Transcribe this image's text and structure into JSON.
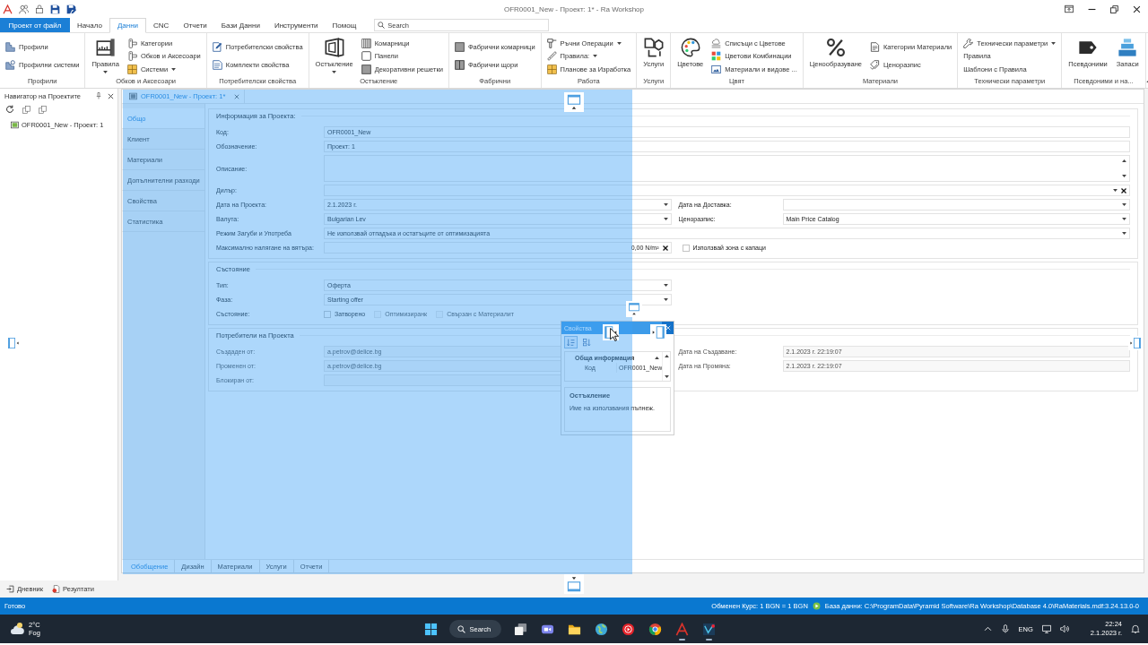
{
  "title_bar": {
    "title": "OFR0001_New - Проект: 1* - Ra Workshop"
  },
  "ribbon": {
    "file_button": "Проект от файл",
    "tabs": [
      {
        "label": "Начало",
        "selected": false
      },
      {
        "label": "Данни",
        "selected": true
      },
      {
        "label": "CNC",
        "selected": false
      },
      {
        "label": "Отчети",
        "selected": false
      },
      {
        "label": "Бази Данни",
        "selected": false
      },
      {
        "label": "Инструменти",
        "selected": false
      },
      {
        "label": "Помощ",
        "selected": false
      }
    ],
    "search": {
      "placeholder": "Search"
    },
    "groups": [
      {
        "label": "Профили",
        "items": [
          {
            "kind": "small",
            "label": "Профили",
            "dropdown": false
          },
          {
            "kind": "small",
            "label": "Профилни системи",
            "dropdown": false
          }
        ]
      },
      {
        "label": "Обков и Аксесоари",
        "items": [
          {
            "kind": "large",
            "label": "Правила",
            "dropdown": true
          },
          {
            "kind": "small",
            "label": "Категории",
            "dropdown": false
          },
          {
            "kind": "small",
            "label": "Обков и Аксесоари",
            "dropdown": false
          },
          {
            "kind": "small",
            "label": "Системи",
            "dropdown": true
          }
        ]
      },
      {
        "label": "Потребителски свойства",
        "items": [
          {
            "kind": "small",
            "label": "Потребителски свойства",
            "dropdown": false
          },
          {
            "kind": "small",
            "label": "Комплекти свойства",
            "dropdown": false
          }
        ]
      },
      {
        "label": "Остъкление",
        "items": [
          {
            "kind": "large",
            "label": "Остъкление",
            "dropdown": true
          },
          {
            "kind": "small",
            "label": "Комарници",
            "dropdown": false
          },
          {
            "kind": "small",
            "label": "Панели",
            "dropdown": false
          },
          {
            "kind": "small",
            "label": "Декоративни решетки",
            "dropdown": false
          }
        ]
      },
      {
        "label": "Фабрични",
        "items": [
          {
            "kind": "small",
            "label": "Фабрични комарници",
            "dropdown": false
          },
          {
            "kind": "small",
            "label": "Фабрични щори",
            "dropdown": false
          }
        ]
      },
      {
        "label": "Работа",
        "items": [
          {
            "kind": "small",
            "label": "Ръчни Операции",
            "dropdown": true
          },
          {
            "kind": "small",
            "label": "Правила:",
            "dropdown": true
          },
          {
            "kind": "small",
            "label": "Планове за Изработка",
            "dropdown": false
          }
        ]
      },
      {
        "label": "Услуги",
        "items": [
          {
            "kind": "large",
            "label": "Услуги",
            "dropdown": false
          }
        ]
      },
      {
        "label": "Цвят",
        "items": [
          {
            "kind": "large",
            "label": "Цветове",
            "dropdown": false
          },
          {
            "kind": "small",
            "label": "Списъци с Цветове",
            "dropdown": false
          },
          {
            "kind": "small",
            "label": "Цветови Комбинации",
            "dropdown": false
          },
          {
            "kind": "small",
            "label": "Материали и видове ...",
            "dropdown": false
          }
        ]
      },
      {
        "label": "Материали",
        "items": [
          {
            "kind": "large",
            "label": "Ценообразуване",
            "dropdown": false
          },
          {
            "kind": "small",
            "label": "Категории Материали",
            "dropdown": false
          },
          {
            "kind": "small",
            "label": "Ценоразпис",
            "dropdown": false
          }
        ]
      },
      {
        "label": "Технически параметри",
        "items": [
          {
            "kind": "small",
            "label": "Технически параметри",
            "dropdown": true
          },
          {
            "kind": "text",
            "label": "Правила",
            "dropdown": false
          },
          {
            "kind": "text",
            "label": "Шаблони с Правила",
            "dropdown": false
          }
        ]
      },
      {
        "label": "Псевдоними и на...",
        "items": [
          {
            "kind": "large",
            "label": "Псевдоними",
            "dropdown": false
          },
          {
            "kind": "large",
            "label": "Запаси",
            "dropdown": false
          }
        ]
      }
    ]
  },
  "navigator": {
    "title": "Навигатор на Проектите",
    "tree": [
      {
        "label": "OFR0001_New - Проект: 1"
      }
    ]
  },
  "document": {
    "tab": {
      "title": "OFR0001_New - Проект: 1*"
    },
    "nav": [
      {
        "label": "Общо",
        "selected": true
      },
      {
        "label": "Клиент",
        "selected": false
      },
      {
        "label": "Материали",
        "selected": false
      },
      {
        "label": "Допълнителни разходи",
        "selected": false
      },
      {
        "label": "Свойства",
        "selected": false
      },
      {
        "label": "Статистика",
        "selected": false
      }
    ],
    "sections": [
      {
        "title": "Информация за Проекта:",
        "rows": [
          {
            "fields": [
              {
                "kind": "text",
                "label": "Код:",
                "value": "OFR0001_New",
                "disabled": false
              }
            ]
          },
          {
            "fields": [
              {
                "kind": "text",
                "label": "Обозначение:",
                "value": "Проект: 1",
                "disabled": false
              }
            ]
          },
          {
            "fields": [
              {
                "kind": "memo",
                "label": "Описание:",
                "disabled": false
              }
            ]
          },
          {
            "fields": [
              {
                "kind": "lookup",
                "label": "Дилър:",
                "disabled": false
              }
            ]
          },
          {
            "fields": [
              {
                "kind": "combo",
                "label": "Дата на Проекта:",
                "value": "2.1.2023 г.",
                "disabled": false
              },
              {
                "kind": "combo",
                "label": "Дата на Доставка:",
                "disabled": false
              }
            ]
          },
          {
            "fields": [
              {
                "kind": "combo",
                "label": "Валута:",
                "value": "Bulgarian Lev",
                "disabled": false
              },
              {
                "kind": "combo",
                "label": "Ценоразпис:",
                "value": "Main Price Catalog",
                "disabled": false
              }
            ]
          },
          {
            "fields": [
              {
                "kind": "combo",
                "label": "Режим Загуби и Употреба",
                "value": "Не използвай отпадъка и остатъците от оптимизацията",
                "disabled": false
              }
            ]
          },
          {
            "fields": [
              {
                "kind": "number",
                "label": "Максимално налягане на вятъра:",
                "value": "0,00 N/m²",
                "disabled": false
              },
              {
                "kind": "checkbox",
                "label": "Използвай зона с капаци",
                "checked": false,
                "disabled": false
              }
            ]
          }
        ]
      },
      {
        "title": "Състояние",
        "rows": [
          {
            "fields": [
              {
                "kind": "combo",
                "label": "Тип:",
                "value": "Оферта",
                "disabled": false
              }
            ]
          },
          {
            "fields": [
              {
                "kind": "combo",
                "label": "Фаза:",
                "value": "Starting offer",
                "disabled": false
              }
            ]
          },
          {
            "fields": [
              {
                "kind": "checks",
                "label": "Състояние:",
                "disabled": false,
                "options": [
                  {
                    "label": "Затворено",
                    "checked": false,
                    "disabled": false
                  },
                  {
                    "label": "Оптимизиранк",
                    "checked": false,
                    "disabled": true
                  },
                  {
                    "label": "Свързан с Материалит",
                    "checked": false,
                    "disabled": true
                  }
                ]
              }
            ]
          }
        ]
      },
      {
        "title": "Потребители на Проекта",
        "rows": [
          {
            "fields": [
              {
                "kind": "text",
                "label": "Създаден от:",
                "value": "a.petrov@delice.bg",
                "disabled": true
              },
              {
                "kind": "text",
                "label": "Дата на Създаване:",
                "value": "2.1.2023 г. 22:19:07",
                "disabled": true
              }
            ]
          },
          {
            "fields": [
              {
                "kind": "text",
                "label": "Променен от:",
                "value": "a.petrov@delice.bg",
                "disabled": true
              },
              {
                "kind": "text",
                "label": "Дата на Промяна:",
                "value": "2.1.2023 г. 22:19:07",
                "disabled": true
              }
            ]
          },
          {
            "fields": [
              {
                "kind": "text",
                "label": "Блокиран от:",
                "disabled": true
              }
            ]
          }
        ]
      }
    ],
    "bottom_tabs": [
      {
        "label": "Обобщение",
        "selected": true
      },
      {
        "label": "Дизайн",
        "selected": false
      },
      {
        "label": "Материали",
        "selected": false
      },
      {
        "label": "Услуги",
        "selected": false
      },
      {
        "label": "Отчети",
        "selected": false
      }
    ]
  },
  "properties_window": {
    "title": "Свойства",
    "sort_buttons": [
      {
        "selected": true
      },
      {
        "selected": false
      }
    ],
    "category": "Обща информация",
    "rows": [
      {
        "name": "Код",
        "value": "OFR0001_New"
      }
    ],
    "description_title": "Остъкление",
    "description": "Име на използвания пълнеж."
  },
  "bottom_panel": {
    "tabs": [
      {
        "label": "Дневник"
      },
      {
        "label": "Резултати"
      }
    ]
  },
  "status_bar": {
    "state": "Готово",
    "exchange_rate": "Обменен Курс: 1 BGN = 1 BGN",
    "database": "База данни: C:\\ProgramData\\Pyramid Software\\Ra Workshop\\Database 4.0\\RaMaterials.mdf:3.24.13.0-0"
  },
  "taskbar": {
    "weather": {
      "temperature": "2°C",
      "condition": "Fog"
    },
    "search_label": "Search",
    "apps": [
      {
        "running": false
      },
      {
        "running": false
      },
      {
        "running": false
      },
      {
        "running": false
      },
      {
        "running": false
      },
      {
        "running": false
      },
      {
        "running": true
      },
      {
        "running": true
      }
    ],
    "language": "ENG",
    "time": "22:24",
    "date": "2.1.2023 г."
  }
}
